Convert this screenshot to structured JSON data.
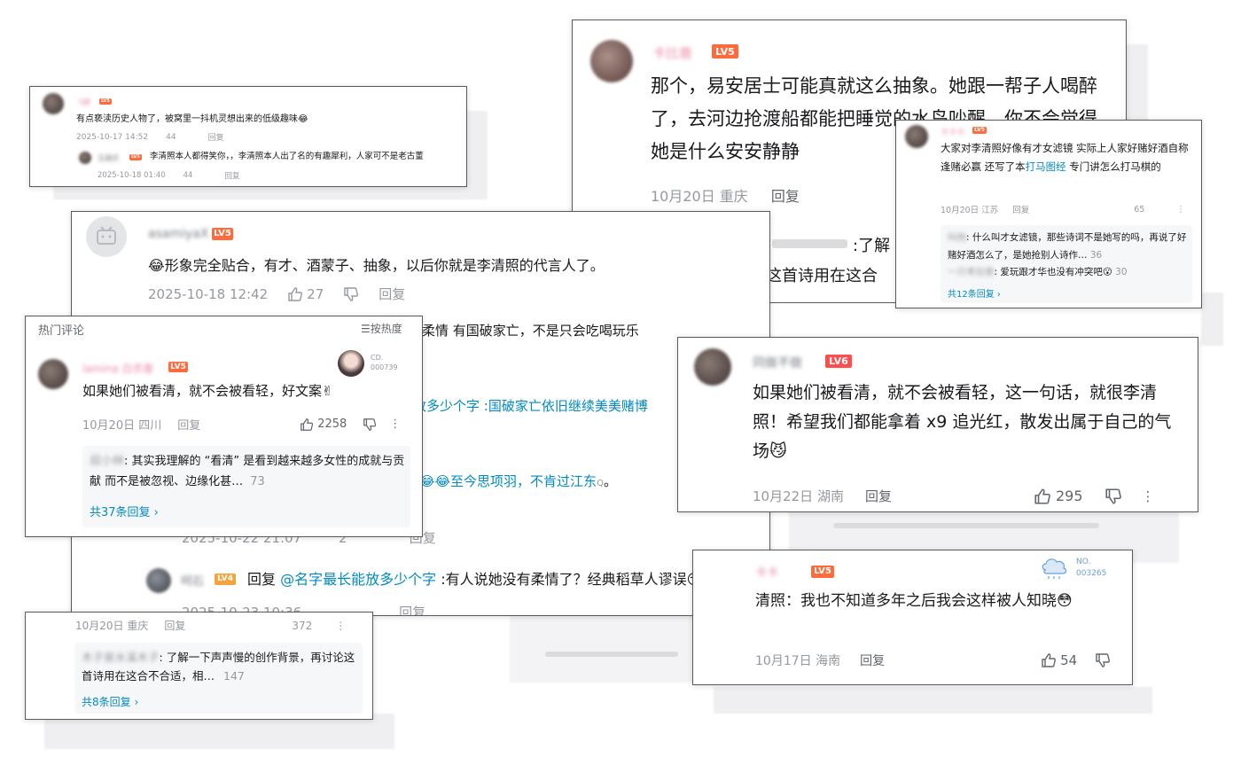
{
  "c1": {
    "body": "有点亵渎历史人物了，被窝里一抖机灵想出来的低级趣味😂",
    "time": "2025-10-17 14:52",
    "likes": "44",
    "reply": "回复",
    "sub_body": "李清照本人都得笑你，，李清照本人出了名的有趣犀利，人家可不是老古董",
    "sub_time": "2025-10-18 01:40",
    "sub_likes": "44",
    "sub_reply": "回复"
  },
  "c2": {
    "username": "asamiyaX",
    "level": "LV5",
    "body": "😂形象完全贴合，有才、酒蒙子、抽象，以后你就是李清照的代言人了。",
    "time": "2025-10-18 12:42",
    "likes": "27",
    "reply": "回复",
    "frag1": "有柔情 有国破家亡，不是只会吃喝玩乐",
    "frag2_a": "放多少个字 ",
    "frag2_b": ":国破家亡依旧继续美美赌博",
    "frag3": "😂😂至今思项羽，不肯过江东",
    "frag4_time": "2025-10-22 21:07",
    "frag4_likes": "2",
    "frag4_reply": "回复",
    "sub_level": "LV4",
    "sub_reply_word": "回复 ",
    "sub_mention": "@名字最长能放多少个字",
    "sub_body": " :有人说她没有柔情了？经典稻草人谬误😏",
    "sub_time": "2025-10-23 10:36",
    "sub_reply": "回复"
  },
  "c3": {
    "level": "LV5",
    "body": "那个，易安居士可能真就这么抽象。她跟一帮子人喝醉了，去河边抢渡船都能把睡觉的水鸟吵醒，你不会觉得她是什么安安静静",
    "time": "10月20日 重庆",
    "reply": "回复",
    "frag_a": ":了解",
    "frag_b": "这首诗用在这合"
  },
  "c4": {
    "level": "LV5",
    "body_a": "大家对李清照好像有才女滤镜 实际上人家好赌好酒自称逢赌必赢 还写了本",
    "body_link": "打马图经",
    "body_b": " 专门讲怎么打马棋的",
    "time": "10月20日 江苏",
    "reply": "回复",
    "likes": "65",
    "r1_body": ": 什么叫才女滤镜，那些诗词不是她写的吗，再说了好赌好酒怎么了，是她抢别人诗作…",
    "r1_likes": "36",
    "r2_body": ": 爱玩跟才华也没有冲突吧😮",
    "r2_likes": "30",
    "more": "共12条回复 ›"
  },
  "c5": {
    "section": "热门评论",
    "sort": "按热度",
    "level": "LV5",
    "badge_label": "CD.",
    "badge_no": "000739",
    "body": "如果她们被看清，就不会被看轻，好文案✌",
    "time": "10月20日 四川",
    "reply": "回复",
    "likes": "2258",
    "sub_body": ": 其实我理解的 “看清” 是看到越来越多女性的成就与贡献 而不是被忽视、边缘化甚…",
    "sub_likes": "73",
    "more": "共37条回复 ›"
  },
  "c6": {
    "time": "10月20日 重庆",
    "reply": "回复",
    "likes": "372",
    "sub_body": ": 了解一下声声慢的创作背景，再讨论这首诗用在这合不合适，相…",
    "sub_likes": "147",
    "more": "共8条回复 ›"
  },
  "c7": {
    "level": "LV6",
    "body": "如果她们被看清，就不会被看轻，这一句话，就很李清照！希望我们都能拿着 x9 追光红，散发出属于自己的气场😼",
    "time": "10月22日 湖南",
    "reply": "回复",
    "likes": "295"
  },
  "c8": {
    "level": "LV5",
    "badge_label": "NO.",
    "badge_no": "003265",
    "body": "清照：我也不知道多年之后我会这样被人知晓😳",
    "time": "10月17日 海南",
    "reply": "回复",
    "likes": "54"
  },
  "colors": {
    "link": "#008ac5",
    "meta": "#9499a0",
    "lv5": "#ff6b3d",
    "lv6": "#ff4d4d",
    "username_pink": "#e88aa4"
  }
}
